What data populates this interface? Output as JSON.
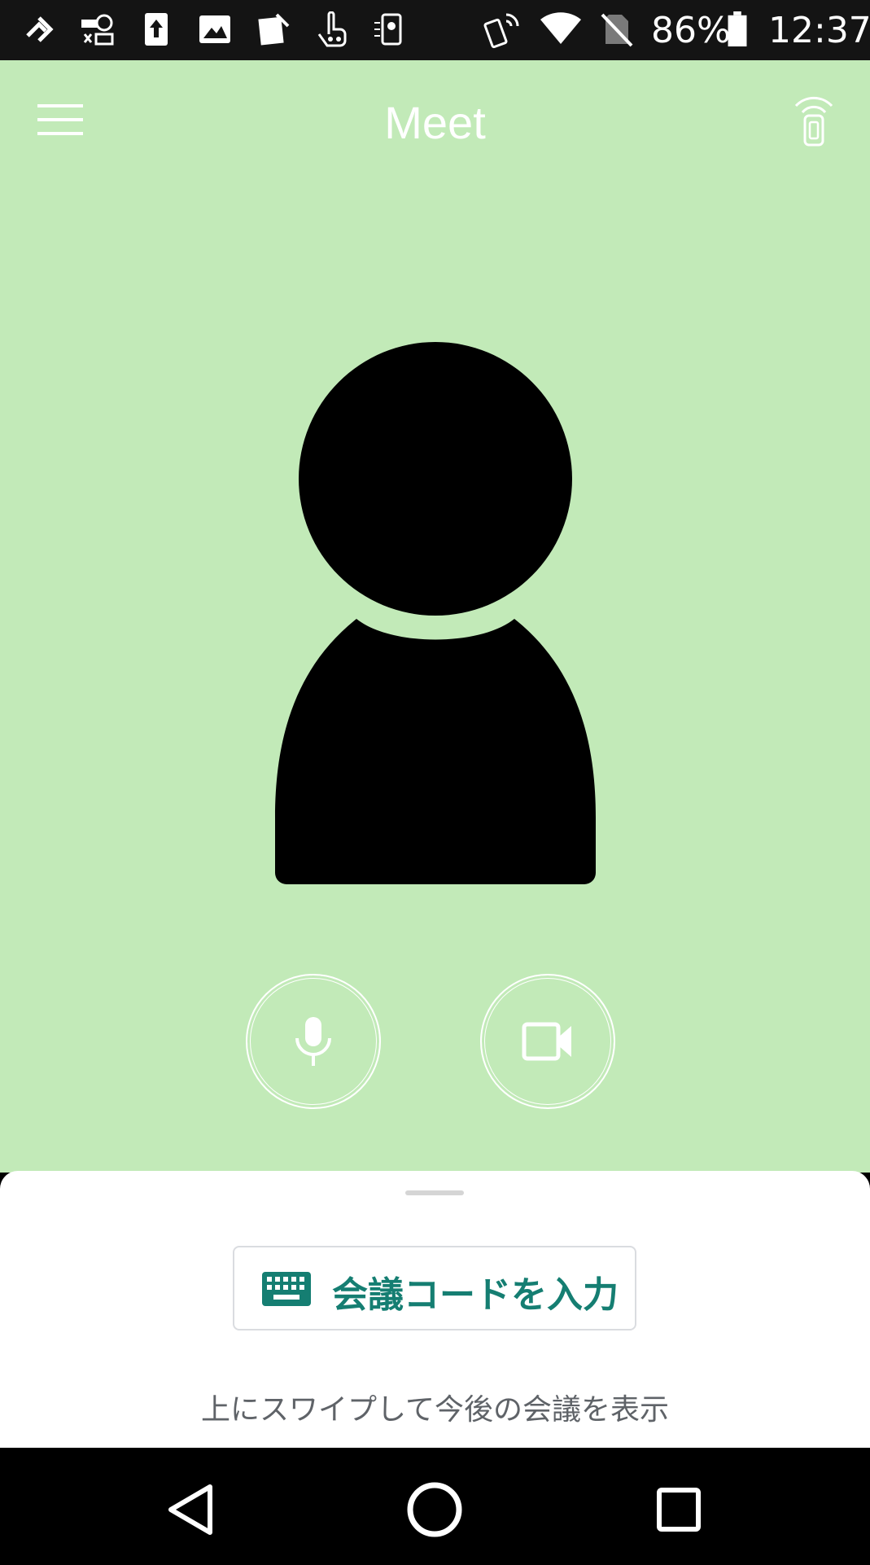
{
  "status_bar": {
    "battery_percent": "86%",
    "time": "12:37",
    "notification_icons": [
      "sync-icon",
      "vpn-key-icon",
      "upload-icon",
      "image-icon",
      "edit-doc-icon",
      "touch-icon",
      "phone-app-icon"
    ],
    "system_icons": [
      "nfc-phone-icon",
      "wifi-icon",
      "no-sim-icon",
      "battery-icon"
    ]
  },
  "app_bar": {
    "title": "Meet",
    "menu_icon": "hamburger-menu-icon",
    "cast_icon": "remote-cast-icon"
  },
  "preview": {
    "avatar_icon": "person-silhouette-icon",
    "background_color": "#c2eab8"
  },
  "controls": {
    "mic_icon": "microphone-icon",
    "camera_icon": "video-camera-icon"
  },
  "bottom_sheet": {
    "enter_code_label": "会議コードを入力",
    "enter_code_icon": "keyboard-icon",
    "swipe_hint": "上にスワイプして今後の会議を表示",
    "accent_color": "#157e72"
  },
  "nav_bar": {
    "back_icon": "back-triangle-icon",
    "home_icon": "home-circle-icon",
    "recents_icon": "recents-square-icon"
  }
}
